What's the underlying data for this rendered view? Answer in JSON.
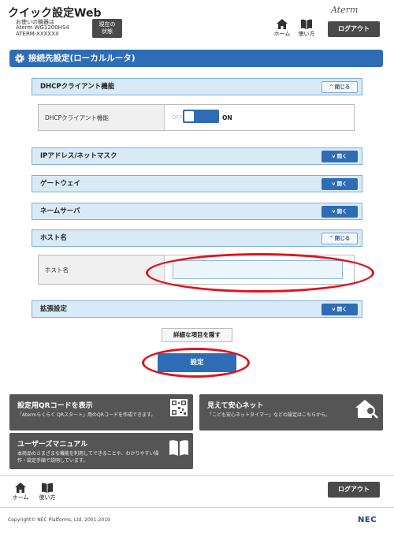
{
  "header": {
    "title": "クイック設定Web",
    "device_label": "お使いの機器は",
    "model": "Aterm WG1200HS4",
    "ssid": "ATERM-XXXXXX",
    "status_button": "現在の\n状態",
    "home_label": "ホーム",
    "manual_label": "使い方",
    "logo": "Aterm",
    "logout_label": "ログアウト"
  },
  "section": {
    "title": "接続先設定(ローカルルータ)"
  },
  "panels": {
    "dhcp": {
      "title": "DHCPクライアント機能",
      "toggle": "閉じる"
    },
    "ip": {
      "title": "IPアドレス/ネットマスク",
      "toggle": "開く"
    },
    "gateway": {
      "title": "ゲートウェイ",
      "toggle": "開く"
    },
    "nameserver": {
      "title": "ネームサーバ",
      "toggle": "開く"
    },
    "host": {
      "title": "ホスト名",
      "toggle": "閉じる"
    },
    "ext": {
      "title": "拡張設定",
      "toggle": "開く"
    }
  },
  "dhcp_row": {
    "label": "DHCPクライアント機能",
    "off": "OFF",
    "on": "ON",
    "state": "on"
  },
  "host_row": {
    "label": "ホスト名",
    "value": ""
  },
  "buttons": {
    "hide_details": "詳細な項目を隠す",
    "submit": "設定"
  },
  "cards": {
    "qr": {
      "title": "設定用QRコードを表示",
      "desc": "「Atermらくらく QRスタート」用のQRコードを作成できます。"
    },
    "safety": {
      "title": "見えて安心ネット",
      "desc": "「こども安心ネットタイマー」などの設定はこちらから。"
    },
    "manual": {
      "title": "ユーザーズマニュアル",
      "desc_line1": "本商品のさまざまな機能を利用してできることや、わかりやすい操",
      "desc_line2": "作・設定手順で説明しています。"
    }
  },
  "footer": {
    "home_label": "ホーム",
    "manual_label": "使い方",
    "logout_label": "ログアウト",
    "copyright": "Copyright© NEC Platforms, Ltd. 2001-2019",
    "brand": "NEC"
  },
  "colors": {
    "primary": "#2e6db5",
    "panel_bg": "#d9eaf7",
    "card_bg": "#555555",
    "highlight": "#e0121e"
  }
}
